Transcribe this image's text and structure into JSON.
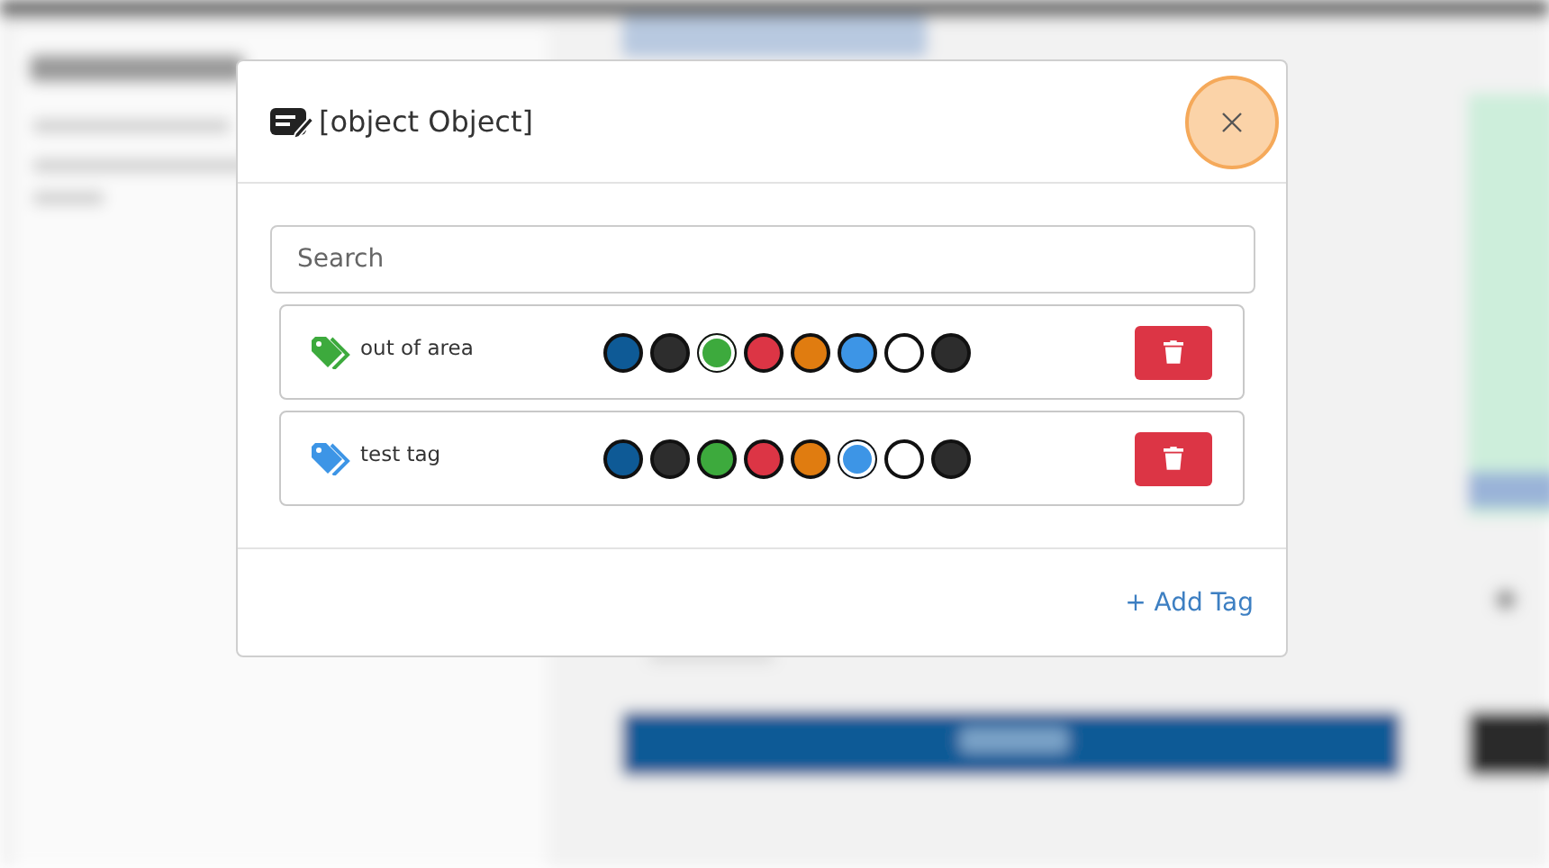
{
  "dialog": {
    "title": "[object Object]",
    "search": {
      "placeholder": "Search"
    },
    "tags": [
      {
        "name": "out of area",
        "color": "#3daa3d",
        "swatches": [
          {
            "color": "#0e5a96",
            "selected": false
          },
          {
            "color": "#2d2d2d",
            "selected": false
          },
          {
            "color": "#3daa3d",
            "selected": true
          },
          {
            "color": "#dc3545",
            "selected": false
          },
          {
            "color": "#e07c10",
            "selected": false
          },
          {
            "color": "#3d95e6",
            "selected": false
          },
          {
            "color": "#ffffff",
            "selected": false
          },
          {
            "color": "#2d2d2d",
            "selected": false
          }
        ]
      },
      {
        "name": "test tag",
        "color": "#3d95e6",
        "swatches": [
          {
            "color": "#0e5a96",
            "selected": false
          },
          {
            "color": "#2d2d2d",
            "selected": false
          },
          {
            "color": "#3daa3d",
            "selected": false
          },
          {
            "color": "#dc3545",
            "selected": false
          },
          {
            "color": "#e07c10",
            "selected": false
          },
          {
            "color": "#3d95e6",
            "selected": true
          },
          {
            "color": "#ffffff",
            "selected": false
          },
          {
            "color": "#2d2d2d",
            "selected": false
          }
        ]
      }
    ],
    "add_button": "+ Add Tag"
  }
}
